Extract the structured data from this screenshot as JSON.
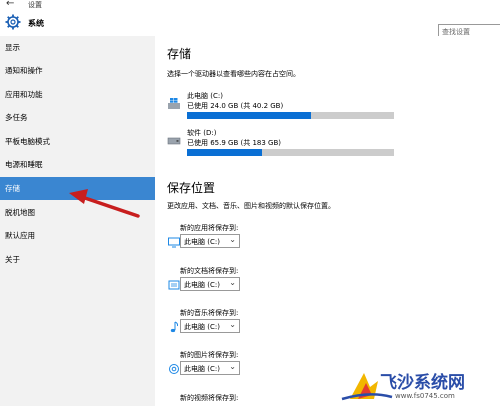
{
  "window": {
    "back": "←",
    "title": "设置"
  },
  "header": {
    "title": "系统",
    "search_placeholder": "查找设置"
  },
  "sidebar": {
    "items": [
      {
        "label": "显示"
      },
      {
        "label": "通知和操作"
      },
      {
        "label": "应用和功能"
      },
      {
        "label": "多任务"
      },
      {
        "label": "平板电脑模式"
      },
      {
        "label": "电源和睡眠"
      },
      {
        "label": "存储"
      },
      {
        "label": "脱机地图"
      },
      {
        "label": "默认应用"
      },
      {
        "label": "关于"
      }
    ],
    "active_index": 6
  },
  "storage": {
    "title": "存储",
    "desc": "选择一个驱动器以查看哪些内容在占空间。",
    "drives": [
      {
        "name": "此电脑 (C:)",
        "used": "已使用 24.0 GB (共 40.2 GB)",
        "fraction": 0.6
      },
      {
        "name": "软件 (D:)",
        "used": "已使用 65.9 GB (共 183 GB)",
        "fraction": 0.36
      }
    ]
  },
  "save_locations": {
    "title": "保存位置",
    "desc": "更改应用、文档、音乐、图片和视频的默认保存位置。",
    "items": [
      {
        "label": "新的应用将保存到:",
        "value": "此电脑 (C:)",
        "icon": "monitor-icon"
      },
      {
        "label": "新的文档将保存到:",
        "value": "此电脑 (C:)",
        "icon": "document-icon"
      },
      {
        "label": "新的音乐将保存到:",
        "value": "此电脑 (C:)",
        "icon": "music-note-icon"
      },
      {
        "label": "新的图片将保存到:",
        "value": "此电脑 (C:)",
        "icon": "camera-icon"
      },
      {
        "label": "新的视频将保存到:",
        "value": ""
      }
    ],
    "chevron": "⌄"
  },
  "watermark": {
    "text": "飞沙系统网",
    "url": "www.fs0745.com"
  },
  "colors": {
    "accent": "#3a86d1",
    "bar_fill": "#0a6fd4",
    "bar_bg": "#cccccc",
    "sidebar_bg": "#f2f2f2"
  }
}
